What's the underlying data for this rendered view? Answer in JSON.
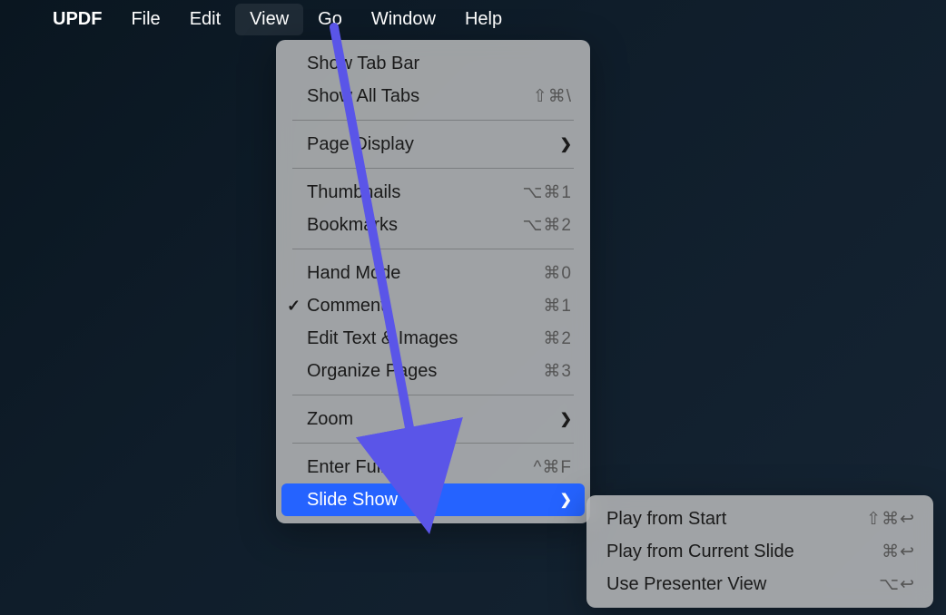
{
  "menubar": {
    "app": "UPDF",
    "items": [
      "File",
      "Edit",
      "View",
      "Go",
      "Window",
      "Help"
    ],
    "active_index": 2
  },
  "view_menu": {
    "groups": [
      [
        {
          "label": "Show Tab Bar",
          "shortcut": "",
          "submenu": false,
          "checked": false
        },
        {
          "label": "Show All Tabs",
          "shortcut": "⇧⌘\\",
          "submenu": false,
          "checked": false
        }
      ],
      [
        {
          "label": "Page Display",
          "shortcut": "",
          "submenu": true,
          "checked": false
        }
      ],
      [
        {
          "label": "Thumbnails",
          "shortcut": "⌥⌘1",
          "submenu": false,
          "checked": false
        },
        {
          "label": "Bookmarks",
          "shortcut": "⌥⌘2",
          "submenu": false,
          "checked": false
        }
      ],
      [
        {
          "label": "Hand Mode",
          "shortcut": "⌘0",
          "submenu": false,
          "checked": false
        },
        {
          "label": "Comment",
          "shortcut": "⌘1",
          "submenu": false,
          "checked": true
        },
        {
          "label": "Edit Text & Images",
          "shortcut": "⌘2",
          "submenu": false,
          "checked": false
        },
        {
          "label": "Organize Pages",
          "shortcut": "⌘3",
          "submenu": false,
          "checked": false
        }
      ],
      [
        {
          "label": "Zoom",
          "shortcut": "",
          "submenu": true,
          "checked": false
        }
      ],
      [
        {
          "label": "Enter Full Screen",
          "shortcut": "^⌘F",
          "submenu": false,
          "checked": false
        },
        {
          "label": "Slide Show",
          "shortcut": "",
          "submenu": true,
          "checked": false,
          "selected": true
        }
      ]
    ]
  },
  "slideshow_submenu": [
    {
      "label": "Play from Start",
      "shortcut": "⇧⌘↩"
    },
    {
      "label": "Play from Current Slide",
      "shortcut": "⌘↩"
    },
    {
      "label": "Use Presenter View",
      "shortcut": "⌥↩"
    }
  ]
}
